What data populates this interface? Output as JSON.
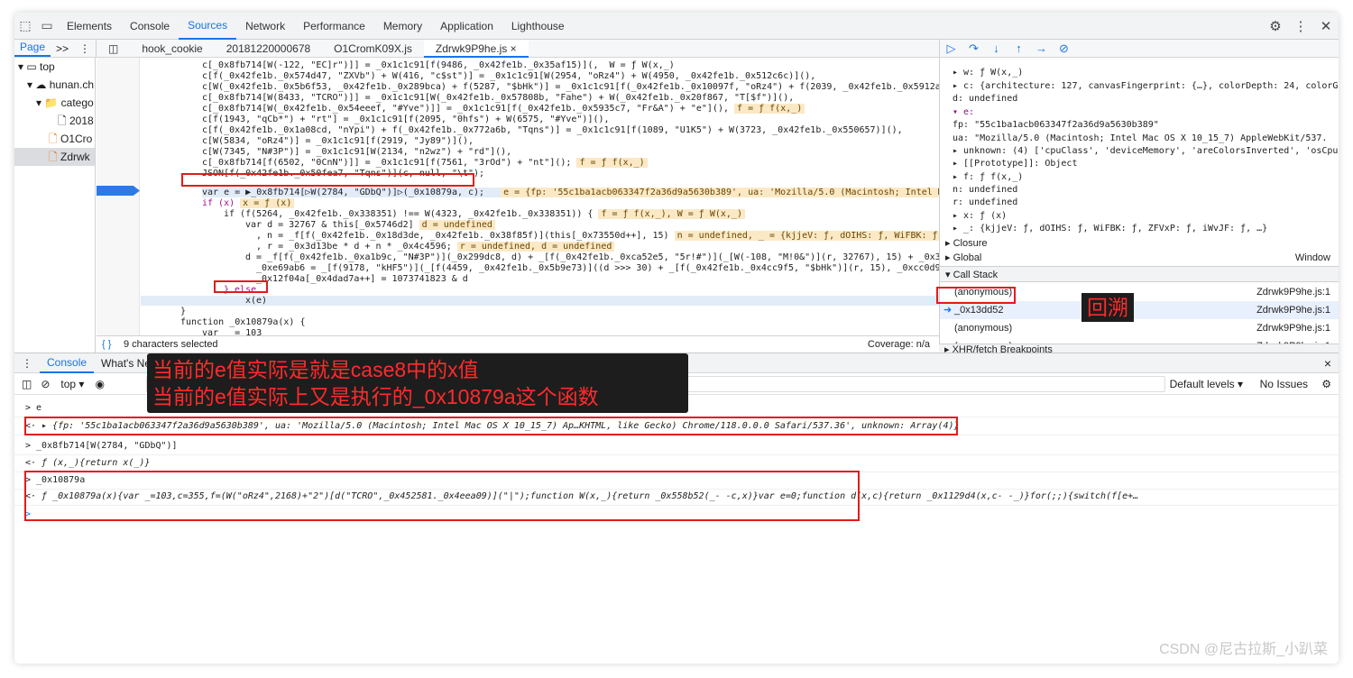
{
  "toolbar": {
    "tabs": [
      "Elements",
      "Console",
      "Sources",
      "Network",
      "Performance",
      "Memory",
      "Application",
      "Lighthouse"
    ],
    "active": "Sources",
    "icons": [
      "inspect-icon",
      "device-icon",
      "gear-icon",
      "kebab-icon",
      "close-icon"
    ]
  },
  "navigator": {
    "tab": "Page",
    "more": ">>",
    "tree": [
      "top",
      "hunan.ch",
      "catego",
      "2018",
      "O1Cro",
      "Zdrwk"
    ]
  },
  "files": {
    "tabs": [
      "hook_cookie",
      "20181220000678",
      "O1CromK09X.js",
      "Zdrwk9P9he.js"
    ],
    "active": "Zdrwk9P9he.js",
    "close": "×"
  },
  "code_lines": [
    "c[_0x8fb714[W(-122, \"EC]r\")]] = _0x1c1c91[f(9486, _0x42fe1b._0x35af15)](,  W = ƒ W(x,_)",
    "c[f(_0x42fe1b._0x574d47, \"ZXVb\") + W(416, \"c$st\")] = _0x1c1c91[W(2954, \"oRz4\") + W(4950, _0x42fe1b._0x512c6c)](),",
    "c[W(_0x42fe1b._0x5b6f53, _0x42fe1b._0x289bca) + f(5287, \"$bHk\")] = _0x1c1c91[f(_0x42fe1b._0x10097f, \"oRz4\") + f(2039, _0x42fe1b._0x5912af)](",
    "c[_0x8fb714[W(8433, \"TCRO\")]] = _0x1c1c91[W(_0x42fe1b._0x57808b, \"Fahe\") + W(_0x42fe1b._0x20f867, \"T[$f\")](),",
    "c[_0x8fb714[W(_0x42fe1b._0x54eeef, \"#Yve\")]] = _0x1c1c91[f(_0x42fe1b._0x5935c7, \"Fr&A\") + \"e\"](),",
    "c[f(1943, \"qCb*\") + \"rt\"] = _0x1c1c91[f(2095, \"0hfs\") + W(6575, \"#Yve\")](),",
    "c[f(_0x42fe1b._0x1a08cd, \"nYpi\") + f(_0x42fe1b._0x772a6b, \"Tqns\")] = _0x1c1c91[f(1089, \"U1K5\") + W(3723, _0x42fe1b._0x550657)](),",
    "c[W(5834, \"oRz4\")] = _0x1c1c91[f(2919, \"Jy89\")](),",
    "c[W(7345, \"N#3P\")] = _0x1c1c91[W(2134, \"n2wz\") + \"rd\"](),",
    "c[_0x8fb714[f(6502, \"0CnN\")]] = _0x1c1c91[f(7561, \"3rOd\") + \"nt\"]();",
    "JSON[f(_0x42fe1b._0x50fea7, \"Tqns\")](c, null, \"\\t\");",
    "var e = ▶_0x8fb714[▷W(2784, \"GDbQ\")]▷(_0x10879a, c);",
    "if (x)",
    "if (f(5264, _0x42fe1b._0x338351) !== W(4323, _0x42fe1b._0x338351)) {",
    "var d = 32767 & this[_0x5746d2]",
    ", n = _f[f(_0x42fe1b._0x18d3de, _0x42fe1b._0x38f85f)](this[_0x73550d++], 15)",
    ", r = _0x3d13be * d + n * _0x4c4596;",
    "d = _f[f(_0x42fe1b._0xa1b9c, \"N#3P\")](_0x299dc8, d) + _[f(_0x42fe1b._0xca52e5, \"5r!#\")](_[W(-108, \"M!0&\")](r, 32767), 15) + _0x3f4ebc",
    "_0xe69ab6 = _[f(9178, \"kHF5\")](_[f(4459, _0x42fe1b._0x5b9e73)]((d >>> 30) + _[f(_0x42fe1b._0x4cc9f5, \"$bHk\")](r, 15), _0xcc0d90 * n)",
    "_0x12f04a[_0x4dad7a++] = 1073741823 & d",
    "} else",
    "x(e)",
    "}",
    "function _0x10879a(x) {",
    "var _ = 103",
    ", c = 355"
  ],
  "inline_values": {
    "f_fx": "f = ƒ f(x,_)",
    "e_val": "e = {fp: '55c1ba1acb063347f2a36d9a5630b389', ua: 'Mozilla/5.0 (Macintosh; Intel Mac O",
    "x_val": "x = ƒ (x)",
    "fw_val": "f = ƒ f(x,_), W = ƒ W(x,_)",
    "d_undef": "d = undefined",
    "n_val": "n = undefined, _ = {kjjeV: ƒ, dOIHS: ƒ, WiFBK: ƒ, ZFV",
    "rd_val": "r = undefined, d = undefined"
  },
  "source_status": {
    "selected": "9 characters selected",
    "coverage": "Coverage: n/a",
    "icon": "{ }"
  },
  "scope": {
    "lines": [
      "▸ w: ƒ W(x,_)",
      "▸ c: {architecture: 127, canvasFingerprint: {…}, colorDepth: 24, colorGam",
      "  d: undefined",
      "▾ e:",
      "    fp: \"55c1ba1acb063347f2a36d9a5630b389\"",
      "    ua: \"Mozilla/5.0 (Macintosh; Intel Mac OS X 10_15_7) AppleWebKit/537.",
      "  ▸ unknown: (4) ['cpuClass', 'deviceMemory', 'areColorsInverted', 'osCpu",
      "  ▸ [[Prototype]]: Object",
      "▸ f: ƒ f(x,_)",
      "  n: undefined",
      "  r: undefined",
      "▸ x: ƒ (x)",
      "▸ _: {kjjeV: ƒ, dOIHS: ƒ, WiFBK: ƒ, ZFVxP: ƒ, iWvJF: ƒ, …}"
    ],
    "closure": "▸ Closure",
    "global": "▸ Global",
    "global_val": "Window",
    "callstack": "▾ Call Stack",
    "frames": [
      {
        "fn": "(anonymous)",
        "loc": "Zdrwk9P9he.js:1"
      },
      {
        "fn": "_0x13dd52",
        "loc": "Zdrwk9P9he.js:1"
      },
      {
        "fn": "(anonymous)",
        "loc": "Zdrwk9P9he.js:1"
      },
      {
        "fn": "(anonymous)",
        "loc": "Zdrwk9P9he.js:1"
      }
    ],
    "xhr": "▸ XHR/fetch Breakpoints"
  },
  "drawer": {
    "tabs": [
      "Console",
      "What's New"
    ],
    "close": "×",
    "context": "top ▾",
    "levels": "Default levels ▾",
    "issues": "No Issues"
  },
  "console_rows": [
    "> e",
    "<· ▸ {fp: '55c1ba1acb063347f2a36d9a5630b389', ua: 'Mozilla/5.0 (Macintosh; Intel Mac OS X 10_15_7) Ap…KHTML, like Gecko) Chrome/118.0.0.0 Safari/537.36', unknown: Array(4)}",
    "> _0x8fb714[W(2784, \"GDbQ\")]",
    "<· ƒ (x,_){return x(_)}",
    "> _0x10879a",
    "<· ƒ _0x10879a(x){var _=103,c=355,f=(W(\"oRz4\",2168)+\"2\")[d(\"TCRO\",_0x452581._0x4eea09)](\"|\");function W(x,_){return _0x558b52(_- -c,x)}var e=0;function d(x,c){return _0x1129d4(x,c- -_)}for(;;){switch(f[e+…",
    ">"
  ],
  "annotations": {
    "note1": "当前的e值实际是就是case8中的x值",
    "note2": "当前的e值实际上又是执行的_0x10879a这个函数",
    "backtrack": "回溯"
  },
  "watermark": "CSDN @尼古拉斯_小趴菜"
}
